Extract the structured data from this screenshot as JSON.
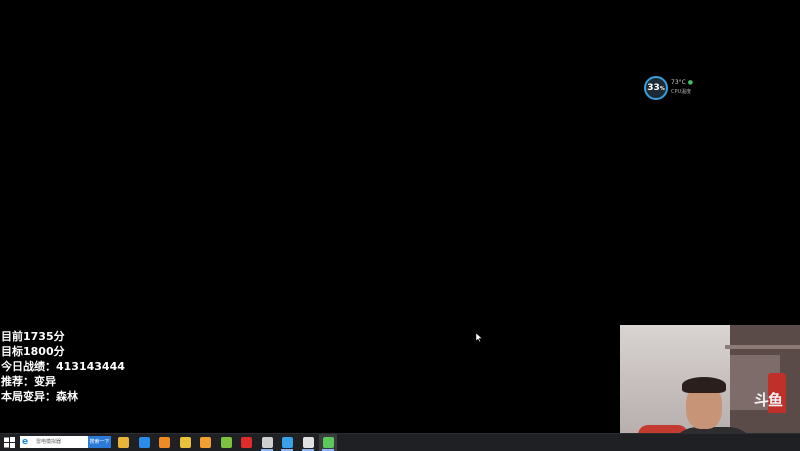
{
  "perf_widget": {
    "cpu_value": "33",
    "cpu_unit": "%",
    "temperature": "73°C",
    "label": "CPU温度"
  },
  "overlay": {
    "lines": [
      "目前1735分",
      "目标1800分",
      "今日战绩：413143444",
      "推荐：变异",
      "本局变异：森林"
    ]
  },
  "webcam": {
    "background_logo": "斗鱼"
  },
  "taskbar": {
    "search_placeholder": "雷电模拟器",
    "search_button": "搜索一下",
    "icons": [
      {
        "name": "file-explorer-icon",
        "color": "#e8b53a"
      },
      {
        "name": "mail-icon",
        "color": "#2b8be8"
      },
      {
        "name": "app-orange-icon",
        "color": "#f08a24"
      },
      {
        "name": "app-ma-icon",
        "color": "#e8c23a"
      },
      {
        "name": "notes-icon",
        "color": "#f0a030"
      },
      {
        "name": "browser-360-icon",
        "color": "#7cc142"
      },
      {
        "name": "netease-music-icon",
        "color": "#e02c2c"
      },
      {
        "name": "ld-player-icon",
        "color": "#cfcfcf"
      },
      {
        "name": "globe-icon",
        "color": "#3aa0e8"
      },
      {
        "name": "moon-app-icon",
        "color": "#e0e0e0"
      },
      {
        "name": "ld-player-active-icon",
        "color": "#5ac85a"
      }
    ]
  }
}
